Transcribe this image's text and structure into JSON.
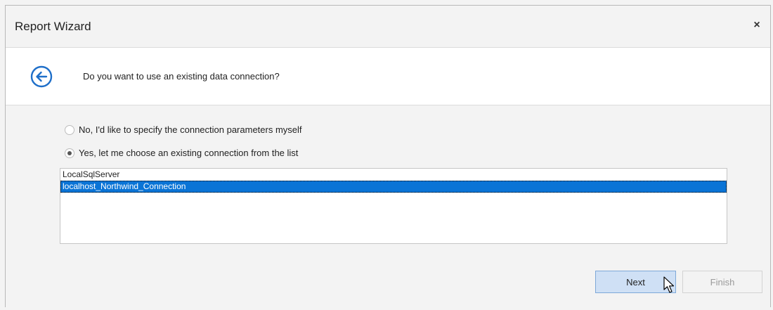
{
  "window": {
    "title": "Report Wizard",
    "close_glyph": "×"
  },
  "header": {
    "back_icon": "arrow-left-circle-icon",
    "question": "Do you want to use an existing data connection?",
    "accent_color": "#1f6fc9"
  },
  "options": [
    {
      "label": "No, I'd like to specify the connection parameters myself",
      "checked": false
    },
    {
      "label": "Yes, let me choose an existing connection from the list",
      "checked": true
    }
  ],
  "connections": {
    "items": [
      "LocalSqlServer",
      "localhost_Northwind_Connection"
    ],
    "selected": "localhost_Northwind_Connection",
    "selection_color": "#0a74d6"
  },
  "buttons": {
    "next_label": "Next",
    "finish_label": "Finish"
  }
}
